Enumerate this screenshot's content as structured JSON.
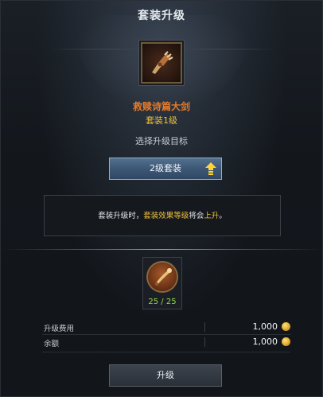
{
  "window": {
    "title": "套装升级"
  },
  "item": {
    "name": "救赎诗篇大剑",
    "set_level": "套装1级",
    "icon": "gauntlet-icon"
  },
  "target": {
    "label": "选择升级目标",
    "selected": "2级套装",
    "icon": "upgrade-arrow-icon"
  },
  "notice": {
    "prefix": "套装升级时，",
    "highlight1": "套装效果等级",
    "middle": "将会",
    "highlight2": "上升",
    "suffix": "。"
  },
  "material": {
    "icon": "horn-icon",
    "count": "25 / 25"
  },
  "costs": [
    {
      "label": "升级费用",
      "value": "1,000",
      "icon": "gold-coin-icon"
    },
    {
      "label": "余额",
      "value": "1,000",
      "icon": "gold-coin-icon"
    }
  ],
  "actions": {
    "upgrade_label": "升级"
  },
  "colors": {
    "item_name": "#e57b2b",
    "highlight": "#f0c23b",
    "material_count": "#8fd64a",
    "button_blue": "#3d5876"
  }
}
